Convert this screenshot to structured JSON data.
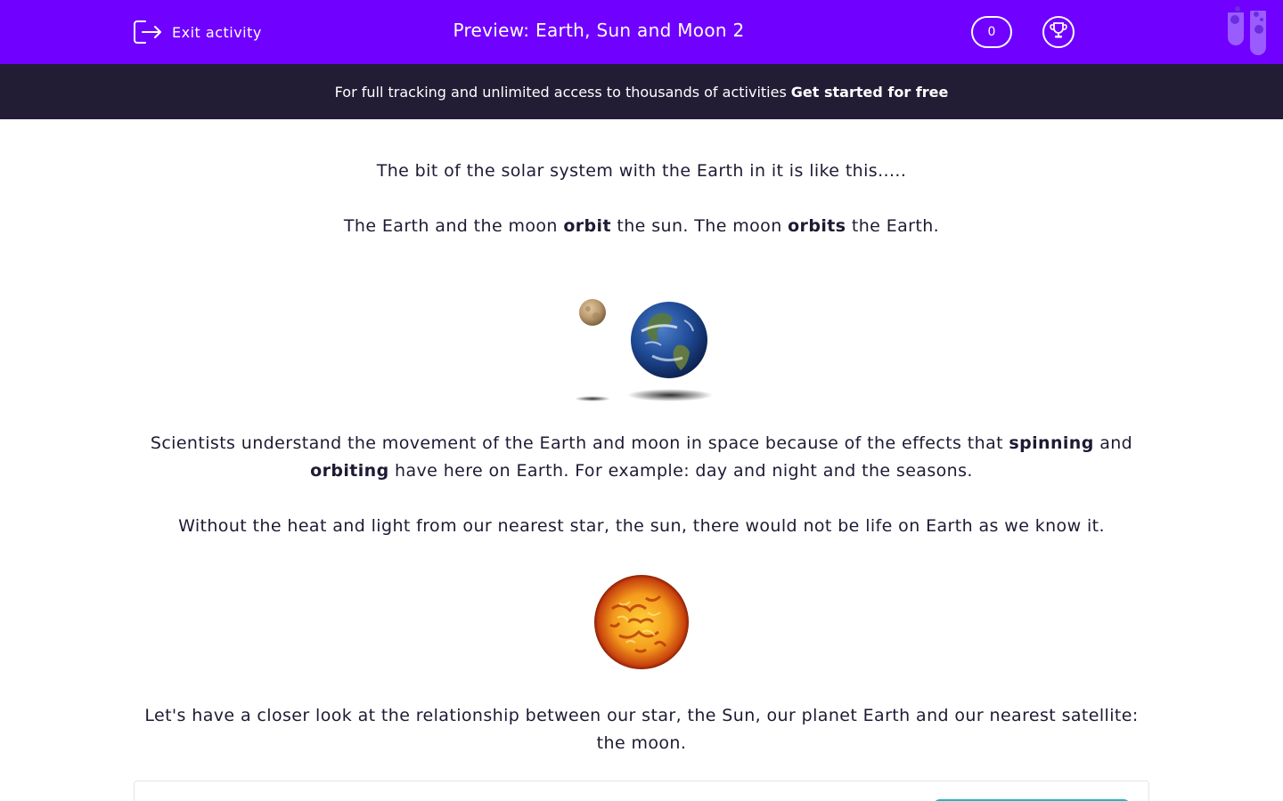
{
  "header": {
    "exit_label": "Exit activity",
    "title": "Preview: Earth, Sun and Moon 2",
    "score": "0",
    "icons": [
      "exit-icon",
      "trophy-icon",
      "test-tubes-logo-icon"
    ],
    "colors": {
      "header_bg": "#7000ff",
      "banner_bg": "#231c35",
      "accent": "#21b8c4"
    }
  },
  "banner": {
    "text": "For full tracking and unlimited access to thousands of activities",
    "cta": "Get started for free"
  },
  "content": {
    "p1": "The bit of the solar system with the Earth in it is like this.....",
    "p2": {
      "a": "The Earth and the moon ",
      "b1": "orbit",
      "c": " the sun. The moon ",
      "b2": "orbits",
      "d": " the Earth."
    },
    "p3": {
      "a": "Scientists understand the movement of the Earth and moon in space because of the effects that ",
      "b1": "spinning",
      "c": " and ",
      "b2": "orbiting",
      "d": " have here on Earth. For example: day and night and the seasons."
    },
    "p4": "Without the heat and light from our nearest star, the sun, there would not be life on Earth as we know it.",
    "p5": "Let's have a closer look at the relationship between our star, the Sun, our planet Earth and our nearest satellite: the moon."
  }
}
